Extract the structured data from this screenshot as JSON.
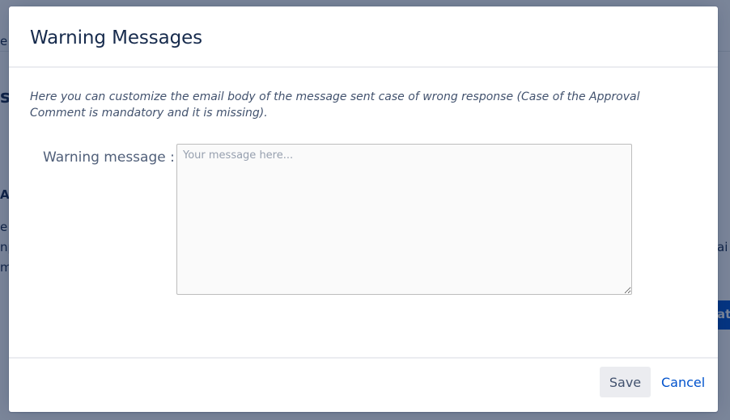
{
  "modal": {
    "title": "Warning Messages",
    "description": "Here you can customize the email body of the message sent case of wrong response (Case of the Approval Comment is mandatory and it is missing).",
    "field": {
      "label": "Warning message :",
      "value": "",
      "placeholder": "Your message here..."
    },
    "save_label": "Save",
    "cancel_label": "Cancel"
  },
  "background": {
    "fragments": [
      "e",
      "s",
      "Ap",
      "e",
      "np",
      "m",
      "ai",
      "at"
    ]
  },
  "colors": {
    "title": "#172b4d",
    "link": "#0052cc",
    "overlay": "rgba(9,30,66,0.54)"
  }
}
